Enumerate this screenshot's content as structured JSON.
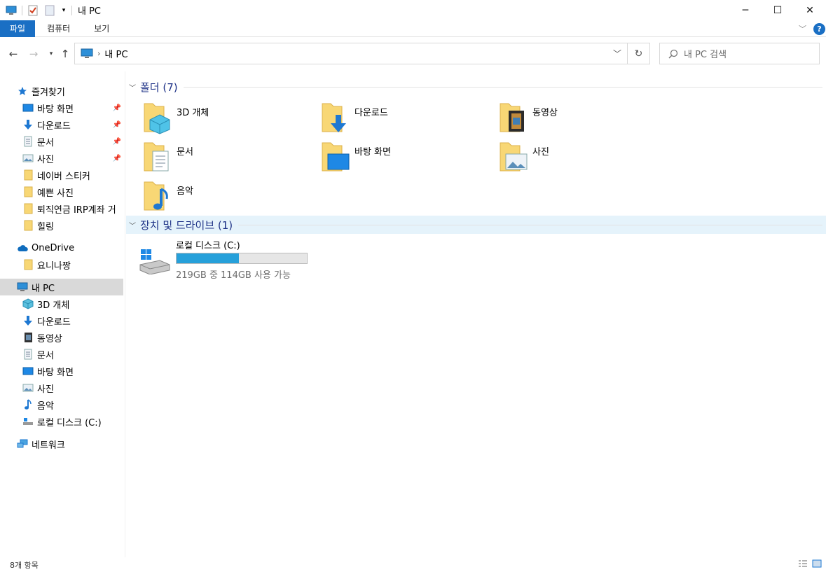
{
  "window": {
    "title": "내 PC"
  },
  "ribbon": {
    "tabs": [
      "파일",
      "컴퓨터",
      "보기"
    ]
  },
  "address": {
    "crumb": "내 PC",
    "search_placeholder": "내 PC 검색"
  },
  "sidebar": {
    "quick_access": "즐겨찾기",
    "quick_items": [
      "바탕 화면",
      "다운로드",
      "문서",
      "사진",
      "네이버 스티커",
      "예쁜 사진",
      "퇴직연금 IRP계좌 거",
      "힐링"
    ],
    "onedrive": "OneDrive",
    "onedrive_items": [
      "요니나짱"
    ],
    "this_pc": "내 PC",
    "pc_items": [
      "3D 개체",
      "다운로드",
      "동영상",
      "문서",
      "바탕 화면",
      "사진",
      "음악",
      "로컬 디스크 (C:)"
    ],
    "network": "네트워크"
  },
  "folders": {
    "header": "폴더 (7)",
    "items": [
      "3D 개체",
      "다운로드",
      "동영상",
      "문서",
      "바탕 화면",
      "사진",
      "음악"
    ]
  },
  "devices": {
    "header": "장치 및 드라이브 (1)",
    "drive_name": "로컬 디스크 (C:)",
    "free_text": "219GB 중 114GB 사용 가능",
    "used_fraction": 0.48
  },
  "status": {
    "count": "8개 항목"
  }
}
